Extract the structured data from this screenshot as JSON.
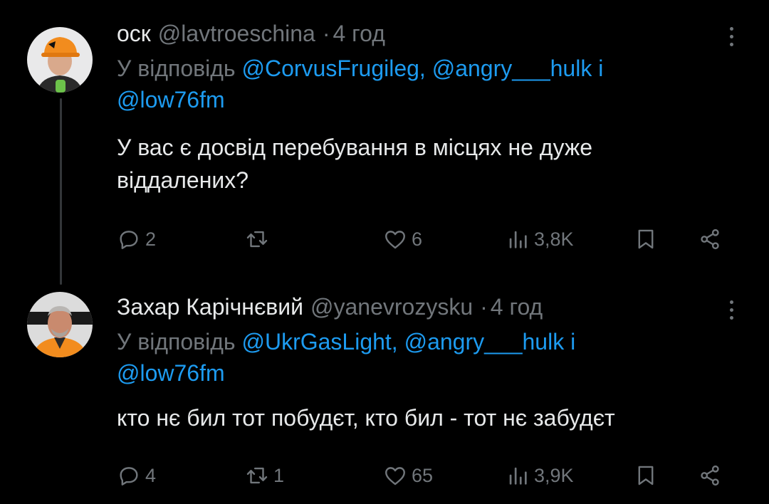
{
  "tweets": [
    {
      "name": "оск",
      "handle": "@lavtroeschina",
      "separator": "·",
      "time": "4 год",
      "reply_prefix": "У відповідь",
      "reply_mentions_1": "@CorvusFrugileg, @angry___hulk",
      "reply_conj": "і",
      "reply_mentions_2": "@low76fm",
      "body_line_1": "У вас є досвід перебування в місцях не дуже",
      "body_line_2": "віддалених?",
      "replies": "2",
      "reposts": "",
      "likes": "6",
      "views": "3,8K"
    },
    {
      "name": "Захар Карічнєвий",
      "handle": "@yanevrozysku",
      "separator": "·",
      "time": "4 год",
      "reply_prefix": "У відповідь",
      "reply_mentions_1": "@UkrGasLight, @angry___hulk",
      "reply_conj": "і",
      "reply_mentions_2": "@low76fm",
      "body_line_1": "кто нє бил тот побудєт, кто бил - тот нє забудєт",
      "body_line_2": "",
      "replies": "4",
      "reposts": "1",
      "likes": "65",
      "views": "3,9K"
    }
  ],
  "colors": {
    "background": "#000000",
    "text": "#e7e9ea",
    "muted": "#71767b",
    "mention": "#1d9bf0",
    "thread_line": "#333639"
  },
  "icons": [
    "reply-icon",
    "repost-icon",
    "like-icon",
    "views-icon",
    "bookmark-icon",
    "share-icon",
    "more-icon"
  ]
}
